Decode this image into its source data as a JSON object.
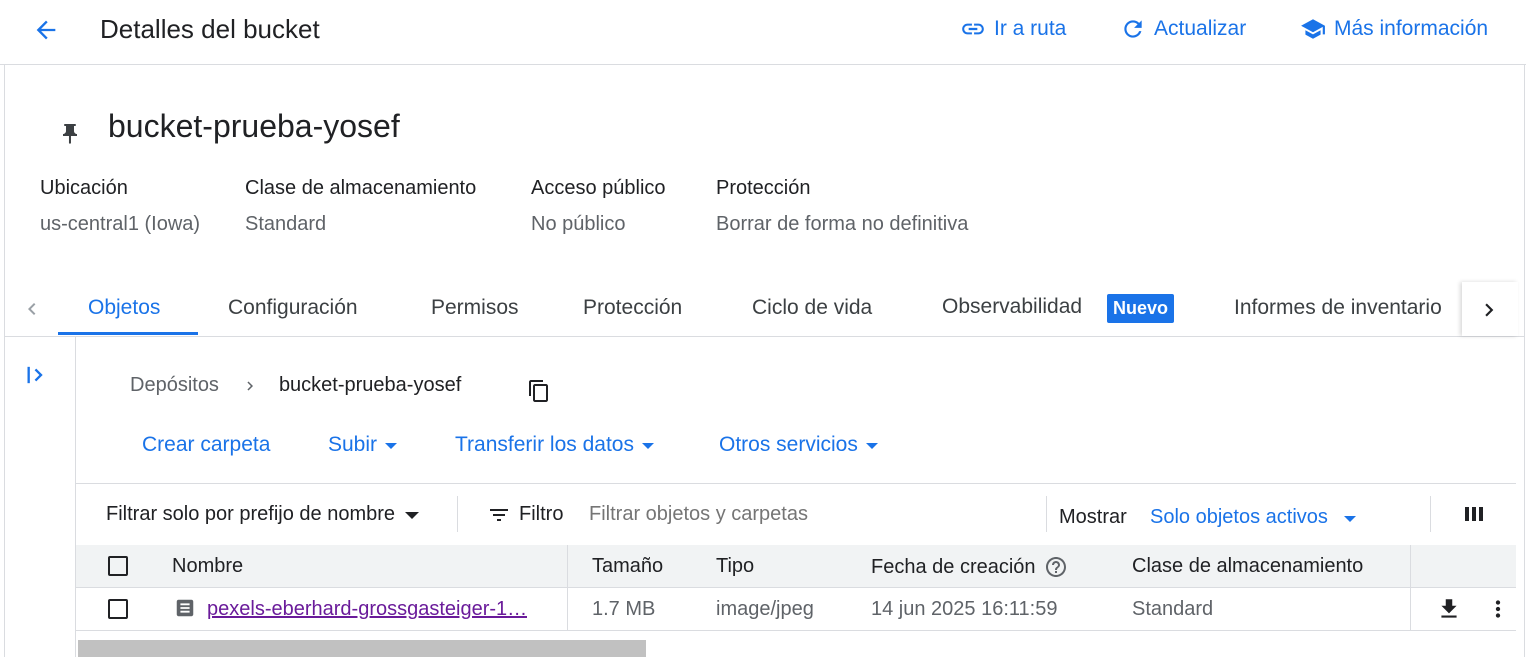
{
  "header": {
    "title": "Detalles del bucket",
    "go_to_path": "Ir a ruta",
    "refresh": "Actualizar",
    "more_info": "Más información"
  },
  "bucket": {
    "name": "bucket-prueba-yosef"
  },
  "meta": {
    "location_label": "Ubicación",
    "location_value": "us-central1 (Iowa)",
    "storage_class_label": "Clase de almacenamiento",
    "storage_class_value": "Standard",
    "public_access_label": "Acceso público",
    "public_access_value": "No público",
    "protection_label": "Protección",
    "protection_value": "Borrar de forma no definitiva"
  },
  "tabs": {
    "objects": "Objetos",
    "configuration": "Configuración",
    "permissions": "Permisos",
    "protection": "Protección",
    "lifecycle": "Ciclo de vida",
    "observability": "Observabilidad",
    "new_badge": "Nuevo",
    "inventory_reports": "Informes de inventario"
  },
  "breadcrumb": {
    "root": "Depósitos",
    "current": "bucket-prueba-yosef"
  },
  "toolbar": {
    "create_folder": "Crear carpeta",
    "upload": "Subir",
    "transfer": "Transferir los datos",
    "other_services": "Otros servicios"
  },
  "filter": {
    "prefix_filter": "Filtrar solo por prefijo de nombre",
    "filter_label": "Filtro",
    "placeholder": "Filtrar objetos y carpetas",
    "show_label": "Mostrar",
    "show_value": "Solo objetos activos"
  },
  "table": {
    "columns": {
      "name": "Nombre",
      "size": "Tamaño",
      "type": "Tipo",
      "created": "Fecha de creación",
      "storage_class": "Clase de almacenamiento"
    },
    "rows": [
      {
        "name": "pexels-eberhard-grossgasteiger-1…",
        "size": "1.7 MB",
        "type": "image/jpeg",
        "created": "14 jun 2025 16:11:59",
        "storage_class": "Standard"
      }
    ]
  },
  "colors": {
    "accent": "#1a73e8",
    "badge_bg": "#1a73e8",
    "link_visited": "#6a1b9a",
    "border": "#dadce0"
  }
}
